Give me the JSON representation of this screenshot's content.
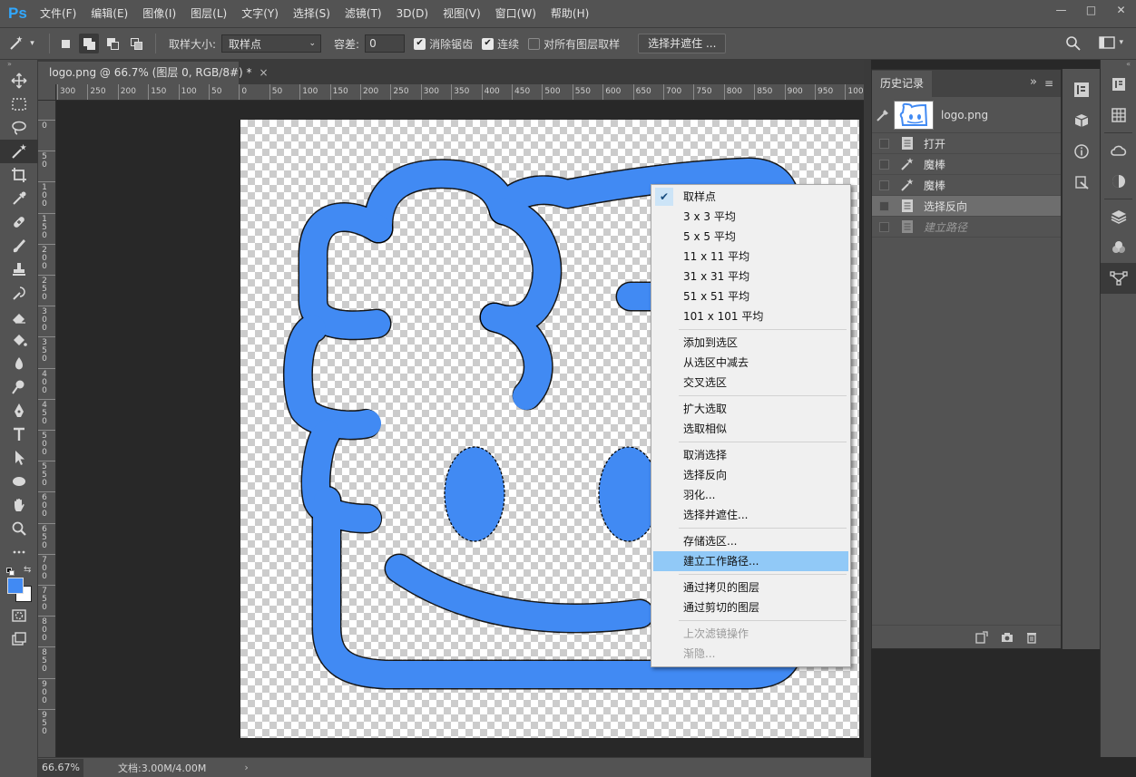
{
  "app": {
    "logo": "Ps"
  },
  "menu": [
    "文件(F)",
    "编辑(E)",
    "图像(I)",
    "图层(L)",
    "文字(Y)",
    "选择(S)",
    "滤镜(T)",
    "3D(D)",
    "视图(V)",
    "窗口(W)",
    "帮助(H)"
  ],
  "window_controls": {
    "minimize": "—",
    "maximize": "□",
    "close": "✕"
  },
  "options": {
    "sample_size_label": "取样大小:",
    "sample_size_value": "取样点",
    "tolerance_label": "容差:",
    "tolerance_value": "0",
    "antialias_label": "消除锯齿",
    "antialias_checked": true,
    "contiguous_label": "连续",
    "contiguous_checked": true,
    "all_layers_label": "对所有图层取样",
    "all_layers_checked": false,
    "select_mask_button": "选择并遮住 ..."
  },
  "document": {
    "tab_title": "logo.png @ 66.7% (图层 0, RGB/8#) *",
    "close_glyph": "×",
    "logo_color": "#418af3"
  },
  "ruler": {
    "top_labels": [
      "300",
      "250",
      "200",
      "150",
      "100",
      "50",
      "0",
      "50",
      "100",
      "150",
      "200",
      "250",
      "300",
      "350",
      "400",
      "450",
      "500",
      "550",
      "600",
      "650",
      "700",
      "750",
      "800",
      "850",
      "900",
      "950",
      "1000"
    ],
    "left_labels": [
      "0",
      "50",
      "100",
      "150",
      "200",
      "250",
      "300",
      "350",
      "400",
      "450",
      "500",
      "550",
      "600",
      "650",
      "700",
      "750",
      "800",
      "850",
      "900",
      "950"
    ]
  },
  "status": {
    "zoom": "66.67%",
    "doc_info": "文档:3.00M/4.00M",
    "arrow": "›"
  },
  "context_menu": {
    "groups": [
      [
        {
          "label": "取样点",
          "checked": true
        },
        {
          "label": "3 x 3 平均"
        },
        {
          "label": "5 x 5 平均"
        },
        {
          "label": "11 x 11 平均"
        },
        {
          "label": "31 x 31 平均"
        },
        {
          "label": "51 x 51 平均"
        },
        {
          "label": "101 x 101 平均"
        }
      ],
      [
        {
          "label": "添加到选区"
        },
        {
          "label": "从选区中减去"
        },
        {
          "label": "交叉选区"
        }
      ],
      [
        {
          "label": "扩大选取"
        },
        {
          "label": "选取相似"
        }
      ],
      [
        {
          "label": "取消选择"
        },
        {
          "label": "选择反向"
        },
        {
          "label": "羽化..."
        },
        {
          "label": "选择并遮住..."
        }
      ],
      [
        {
          "label": "存储选区..."
        },
        {
          "label": "建立工作路径...",
          "highlighted": true
        }
      ],
      [
        {
          "label": "通过拷贝的图层"
        },
        {
          "label": "通过剪切的图层"
        }
      ],
      [
        {
          "label": "上次滤镜操作",
          "disabled": true
        },
        {
          "label": "渐隐...",
          "disabled": true
        }
      ]
    ]
  },
  "history_panel": {
    "tab": "历史记录",
    "collapse_glyph": "»",
    "menu_glyph": "≡",
    "snapshot_name": "logo.png",
    "states": [
      {
        "label": "打开",
        "icon": "document-icon"
      },
      {
        "label": "魔棒",
        "icon": "magic-wand-icon"
      },
      {
        "label": "魔棒",
        "icon": "magic-wand-icon"
      },
      {
        "label": "选择反向",
        "icon": "document-icon",
        "selected": true
      },
      {
        "label": "建立路径",
        "icon": "document-icon",
        "future": true
      }
    ]
  }
}
